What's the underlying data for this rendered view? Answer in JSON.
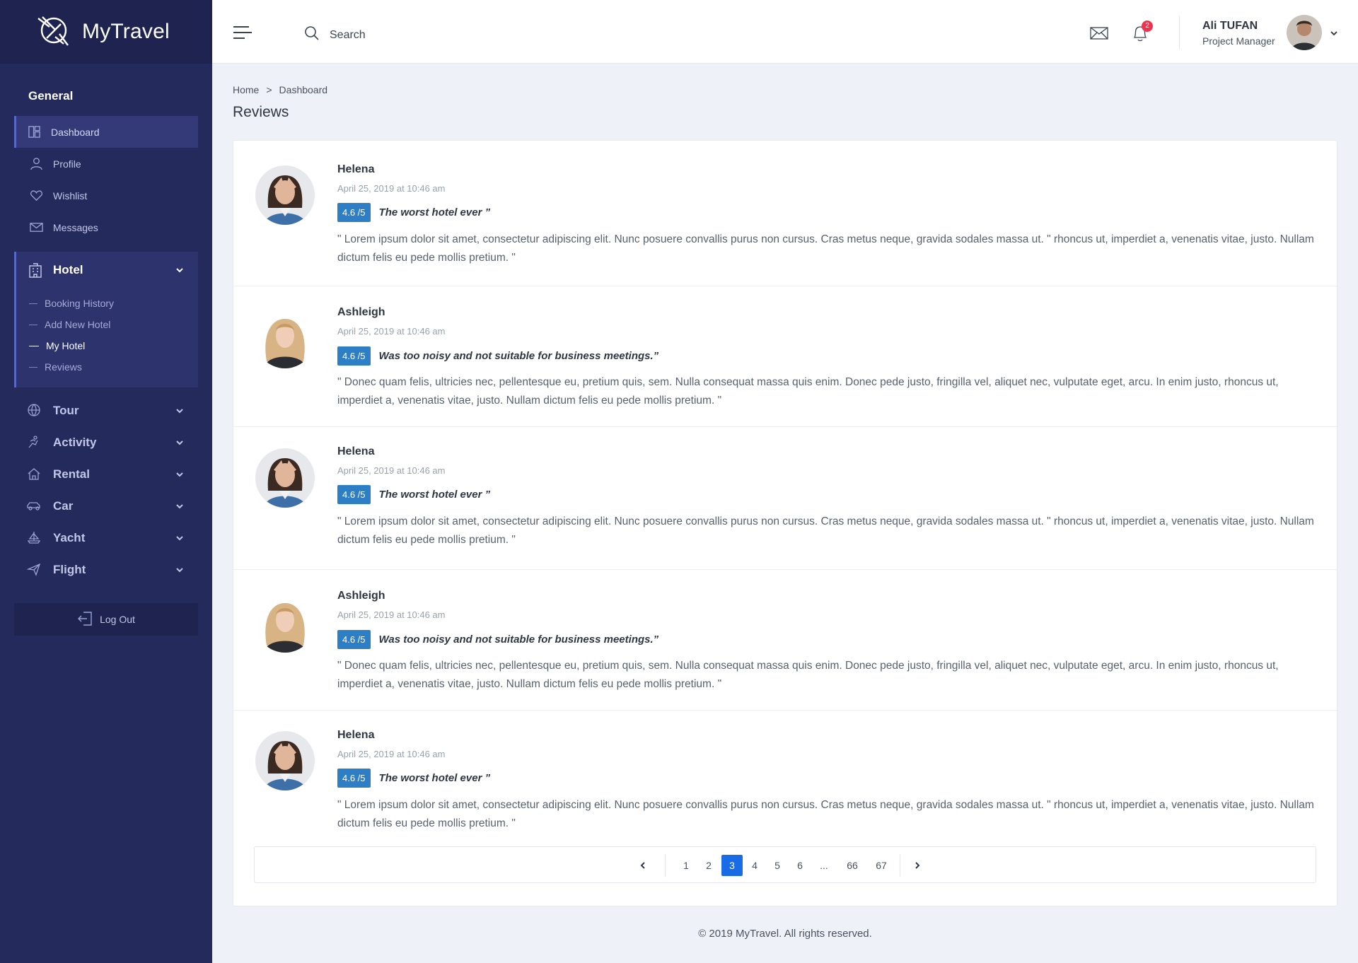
{
  "brand": {
    "name": "MyTravel"
  },
  "sidebar": {
    "section_title": "General",
    "nav": [
      {
        "label": "Dashboard",
        "icon": "dashboard-icon"
      },
      {
        "label": "Profile",
        "icon": "user-icon"
      },
      {
        "label": "Wishlist",
        "icon": "heart-icon"
      },
      {
        "label": "Messages",
        "icon": "mail-icon"
      }
    ],
    "hotel_group": {
      "label": "Hotel",
      "items": [
        "Booking History",
        "Add New Hotel",
        "My Hotel",
        "Reviews"
      ],
      "current": "My Hotel"
    },
    "menu": [
      {
        "label": "Tour",
        "icon": "globe-icon"
      },
      {
        "label": "Activity",
        "icon": "activity-icon"
      },
      {
        "label": "Rental",
        "icon": "home-icon"
      },
      {
        "label": "Car",
        "icon": "car-icon"
      },
      {
        "label": "Yacht",
        "icon": "yacht-icon"
      },
      {
        "label": "Flight",
        "icon": "plane-icon"
      }
    ],
    "logout_label": "Log Out"
  },
  "header": {
    "search_placeholder": "Search",
    "notification_count": "2",
    "user_name": "Ali TUFAN",
    "user_role": "Project Manager"
  },
  "breadcrumb": {
    "home": "Home",
    "separator": ">",
    "current": "Dashboard"
  },
  "page_title": "Reviews",
  "reviews": [
    {
      "name": "Helena",
      "date": "April 25, 2019 at 10:46 am",
      "score": "4.6 /5",
      "title": "The worst hotel ever ”",
      "text": "\" Lorem ipsum dolor sit amet, consectetur adipiscing elit. Nunc posuere convallis purus non cursus. Cras metus neque, gravida sodales massa ut. \" rhoncus ut, imperdiet a, venenatis vitae, justo. Nullam dictum felis eu pede mollis pretium. \""
    },
    {
      "name": "Ashleigh",
      "date": "April 25, 2019 at 10:46 am",
      "score": "4.6 /5",
      "title": "Was too noisy and not suitable for business meetings.”",
      "text": "\" Donec quam felis, ultricies nec, pellentesque eu, pretium quis, sem. Nulla consequat massa quis enim. Donec pede justo, fringilla vel, aliquet nec, vulputate eget, arcu. In enim justo, rhoncus ut, imperdiet a, venenatis vitae, justo. Nullam dictum felis eu pede mollis pretium. \""
    },
    {
      "name": "Helena",
      "date": "April 25, 2019 at 10:46 am",
      "score": "4.6 /5",
      "title": "The worst hotel ever ”",
      "text": "\" Lorem ipsum dolor sit amet, consectetur adipiscing elit. Nunc posuere convallis purus non cursus. Cras metus neque, gravida sodales massa ut. \" rhoncus ut, imperdiet a, venenatis vitae, justo. Nullam dictum felis eu pede mollis pretium. \""
    },
    {
      "name": "Ashleigh",
      "date": "April 25, 2019 at 10:46 am",
      "score": "4.6 /5",
      "title": "Was too noisy and not suitable for business meetings.”",
      "text": "\" Donec quam felis, ultricies nec, pellentesque eu, pretium quis, sem. Nulla consequat massa quis enim. Donec pede justo, fringilla vel, aliquet nec, vulputate eget, arcu. In enim justo, rhoncus ut, imperdiet a, venenatis vitae, justo. Nullam dictum felis eu pede mollis pretium. \""
    },
    {
      "name": "Helena",
      "date": "April 25, 2019 at 10:46 am",
      "score": "4.6 /5",
      "title": "The worst hotel ever ”",
      "text": "\" Lorem ipsum dolor sit amet, consectetur adipiscing elit. Nunc posuere convallis purus non cursus. Cras metus neque, gravida sodales massa ut. \" rhoncus ut, imperdiet a, venenatis vitae, justo. Nullam dictum felis eu pede mollis pretium. \""
    }
  ],
  "pagination": {
    "pages": [
      "1",
      "2",
      "3",
      "4",
      "5",
      "6",
      "...",
      "66",
      "67"
    ],
    "current": "3"
  },
  "footer": "© 2019 MyTravel. All rights reserved.",
  "colors": {
    "sidebar": "#242a5c",
    "accent": "#1a6be6",
    "score": "#2e7ec6",
    "badge": "#f0324c"
  }
}
